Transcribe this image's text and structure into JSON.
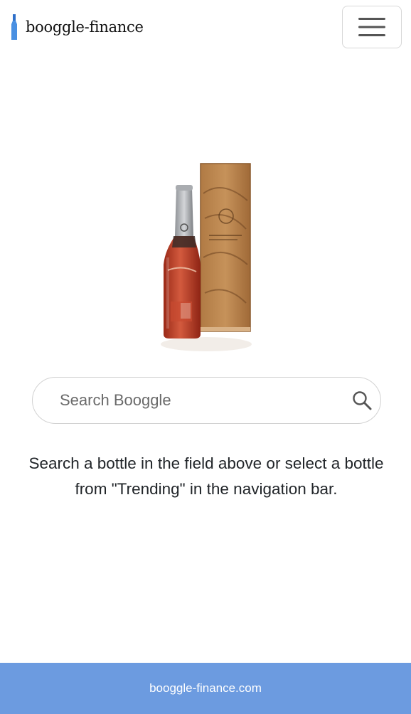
{
  "navbar": {
    "brand": "booggle-finance",
    "menu_icon": "hamburger-menu-icon"
  },
  "hero": {
    "image": "bourbon-bottle-with-wooden-box"
  },
  "search": {
    "placeholder": "Search Booggle",
    "value": "",
    "icon": "search-icon"
  },
  "main": {
    "info_text": "Search a bottle in the field above or select a bottle from \"Trending\" in the navigation bar."
  },
  "footer": {
    "link": "booggle-finance.com",
    "background": "#6c9be0"
  },
  "colors": {
    "accent": "#4a90e2",
    "text": "#212529"
  }
}
